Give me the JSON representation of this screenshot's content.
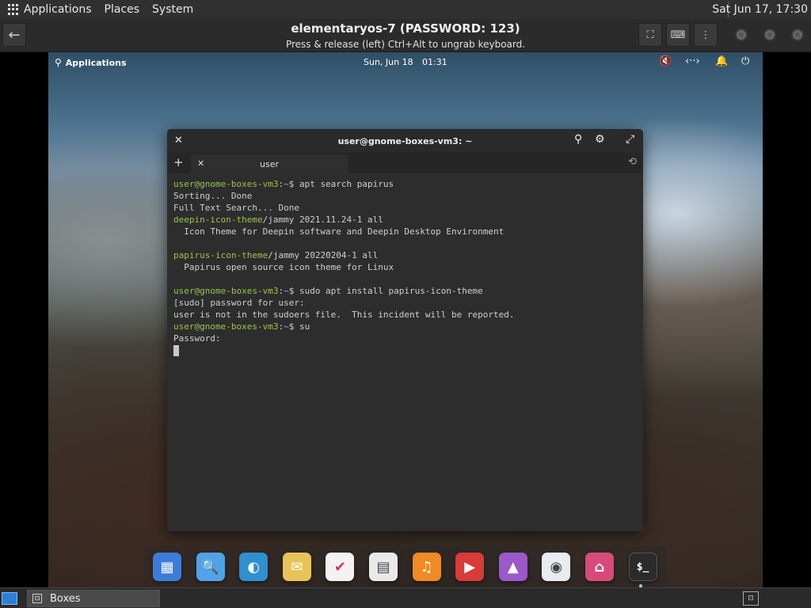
{
  "host_panel": {
    "menus": [
      "Applications",
      "Places",
      "System"
    ],
    "clock": "Sat Jun 17, 17:30"
  },
  "boxes_header": {
    "title": "elementaryos-7 (PASSWORD: 123)",
    "subtitle": "Press & release (left) Ctrl+Alt to ungrab keyboard.",
    "icons": [
      "back-arrow-icon",
      "fullscreen-icon",
      "keyboard-icon",
      "menu-dots-icon"
    ]
  },
  "guest_panel": {
    "applications": "Applications",
    "date": "Sun, Jun 18",
    "time": "01:31"
  },
  "terminal": {
    "title": "user@gnome-boxes-vm3: ~",
    "tab_label": "user",
    "lines": [
      [
        {
          "t": "user@gnome-boxes-vm3",
          "c": "g"
        },
        {
          "t": ":",
          "c": ""
        },
        {
          "t": "~",
          "c": "b"
        },
        {
          "t": "$ apt search papirus",
          "c": ""
        }
      ],
      [
        {
          "t": "Sorting... Done",
          "c": ""
        }
      ],
      [
        {
          "t": "Full Text Search... Done",
          "c": ""
        }
      ],
      [
        {
          "t": "deepin-icon-theme",
          "c": "g"
        },
        {
          "t": "/jammy 2021.11.24-1 all",
          "c": ""
        }
      ],
      [
        {
          "t": "  Icon Theme for Deepin software and Deepin Desktop Environment",
          "c": ""
        }
      ],
      [],
      [
        {
          "t": "papirus-icon-theme",
          "c": "g"
        },
        {
          "t": "/jammy 20220204-1 all",
          "c": ""
        }
      ],
      [
        {
          "t": "  Papirus open source icon theme for Linux",
          "c": ""
        }
      ],
      [],
      [
        {
          "t": "user@gnome-boxes-vm3",
          "c": "g"
        },
        {
          "t": ":",
          "c": ""
        },
        {
          "t": "~",
          "c": "b"
        },
        {
          "t": "$ sudo apt install papirus-icon-theme",
          "c": ""
        }
      ],
      [
        {
          "t": "[sudo] password for user:",
          "c": ""
        }
      ],
      [
        {
          "t": "user is not in the sudoers file.  This incident will be reported.",
          "c": ""
        }
      ],
      [
        {
          "t": "user@gnome-boxes-vm3",
          "c": "g"
        },
        {
          "t": ":",
          "c": ""
        },
        {
          "t": "~",
          "c": "b"
        },
        {
          "t": "$ su",
          "c": ""
        }
      ],
      [
        {
          "t": "Password:",
          "c": ""
        }
      ]
    ]
  },
  "dock": {
    "apps": [
      {
        "name": "multitasking-view",
        "bg": "#3b7dd8",
        "glyph": "▦"
      },
      {
        "name": "files",
        "bg": "#4fa3e8",
        "glyph": "🔍"
      },
      {
        "name": "web-browser",
        "bg": "#2f8fd0",
        "glyph": "◐"
      },
      {
        "name": "mail",
        "bg": "#e8c35a",
        "glyph": "✉"
      },
      {
        "name": "tasks",
        "bg": "#f2f2f2",
        "glyph": "✔"
      },
      {
        "name": "calendar",
        "bg": "#e9e9e9",
        "glyph": "▤"
      },
      {
        "name": "music",
        "bg": "#f08a24",
        "glyph": "♫"
      },
      {
        "name": "videos",
        "bg": "#d93a3a",
        "glyph": "▶"
      },
      {
        "name": "photos",
        "bg": "#9b59c9",
        "glyph": "▲"
      },
      {
        "name": "settings",
        "bg": "#e8ecf0",
        "glyph": "◉"
      },
      {
        "name": "appcenter",
        "bg": "#d84a7a",
        "glyph": "⌂"
      },
      {
        "name": "terminal",
        "bg": "#2b2b2b",
        "glyph": "$_"
      }
    ]
  },
  "host_bottom": {
    "task_label": "Boxes"
  }
}
